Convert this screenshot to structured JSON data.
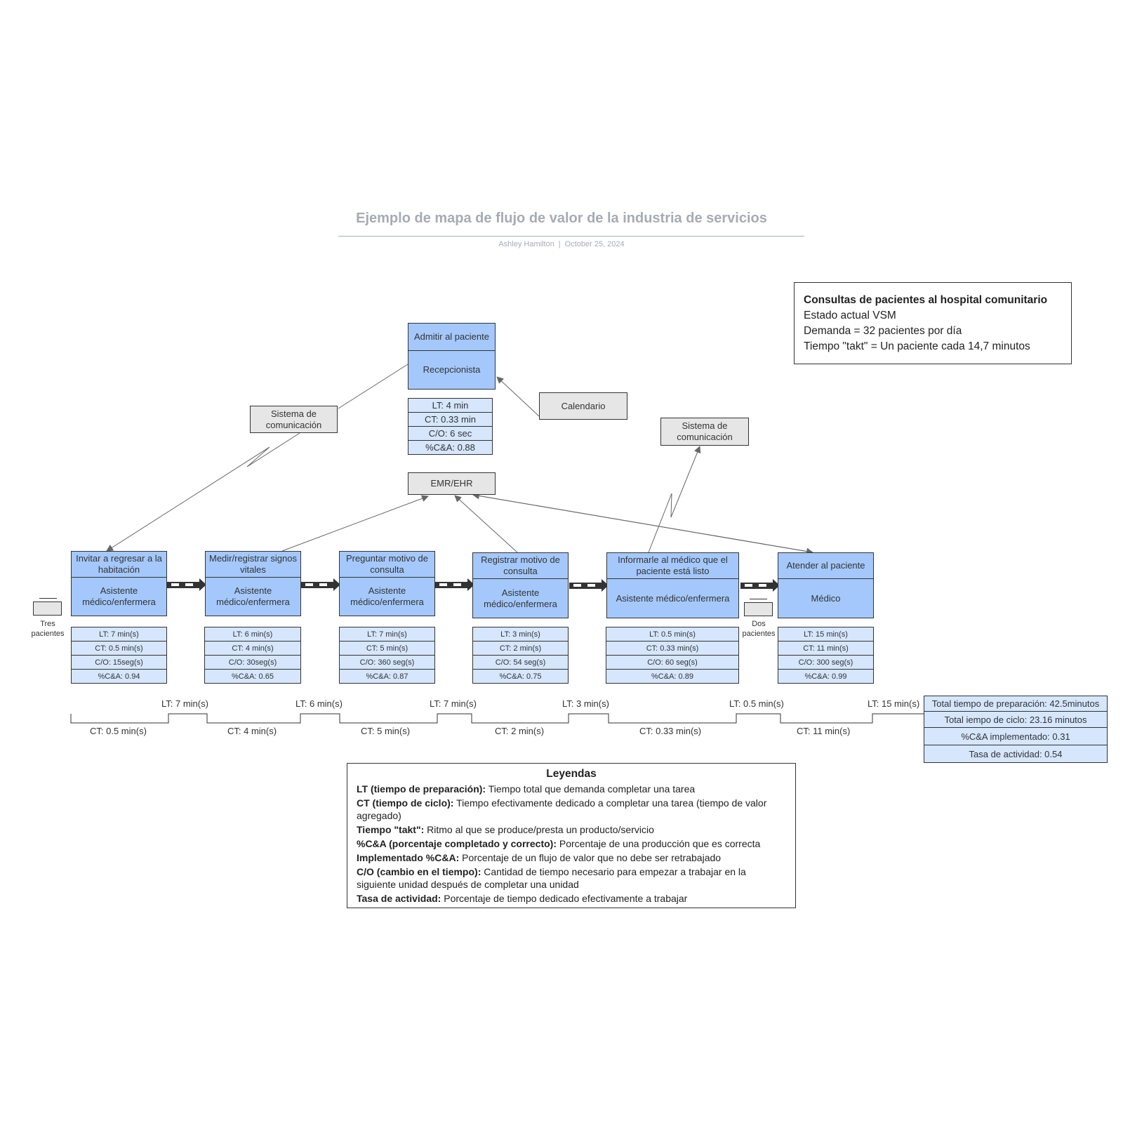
{
  "header": {
    "title": "Ejemplo de mapa de flujo de valor de la industria de servicios",
    "author": "Ashley Hamilton",
    "separator": "|",
    "date": "October 25, 2024"
  },
  "info_box": {
    "title": "Consultas de pacientes al hospital comunitario",
    "lines": [
      "Estado actual VSM",
      "Demanda = 32 pacientes por día",
      "Tiempo \"takt\" = Un paciente cada 14,7 minutos"
    ]
  },
  "admit": {
    "title": "Admitir al paciente",
    "role": "Recepcionista",
    "data": [
      "LT: 4 min",
      "CT: 0.33 min",
      "C/O: 6 sec",
      "%C&A: 0.88"
    ]
  },
  "external": {
    "calendar": "Calendario",
    "comm_left": "Sistema de comunicación",
    "comm_right": "Sistema de comunicación",
    "emr": "EMR/EHR"
  },
  "processes": [
    {
      "title": "Invitar a regresar a la habitación",
      "role": "Asistente médico/enfermera",
      "data": [
        "LT: 7 min(s)",
        "CT: 0.5 min(s)",
        "C/O: 15seg(s)",
        "%C&A: 0.94"
      ]
    },
    {
      "title": "Medir/registrar signos vitales",
      "role": "Asistente médico/enfermera",
      "data": [
        "LT: 6 min(s)",
        "CT: 4 min(s)",
        "C/O: 30seg(s)",
        "%C&A: 0.65"
      ]
    },
    {
      "title": "Preguntar motivo de consulta",
      "role": "Asistente médico/enfermera",
      "data": [
        "LT: 7 min(s)",
        "CT: 5 min(s)",
        "C/O: 360 seg(s)",
        "%C&A: 0.87"
      ]
    },
    {
      "title": "Registrar motivo de consulta",
      "role": "Asistente médico/enfermera",
      "data": [
        "LT: 3 min(s)",
        "CT: 2 min(s)",
        "C/O: 54 seg(s)",
        "%C&A: 0.75"
      ]
    },
    {
      "title": "Informarle al médico que el paciente está listo",
      "role": "Asistente médico/enfermera",
      "data": [
        "LT: 0.5 min(s)",
        "CT: 0.33 min(s)",
        "C/O: 60 seg(s)",
        "%C&A: 0.89"
      ]
    },
    {
      "title": "Atender al paciente",
      "role": "Médico",
      "data": [
        "LT: 15 min(s)",
        "CT: 11 min(s)",
        "C/O: 300 seg(s)",
        "%C&A: 0.99"
      ]
    }
  ],
  "inventory": {
    "first": "Tres pacientes",
    "second": "Dos pacientes"
  },
  "timeline": {
    "lt": [
      "LT: 7 min(s)",
      "LT: 6 min(s)",
      "LT: 7 min(s)",
      "LT: 3 min(s)",
      "LT: 0.5 min(s)",
      "LT: 15 min(s)"
    ],
    "ct": [
      "CT: 0.5 min(s)",
      "CT: 4 min(s)",
      "CT: 5 min(s)",
      "CT: 2 min(s)",
      "CT: 0.33 min(s)",
      "CT: 11 min(s)"
    ]
  },
  "totals": [
    "Total tiempo de preparación: 42.5minutos",
    "Total iempo de ciclo: 23.16 minutos",
    "%C&A implementado: 0.31",
    "Tasa de actividad: 0.54"
  ],
  "legend": {
    "title": "Leyendas",
    "items": [
      {
        "term": "LT (tiempo de preparación):",
        "def": " Tiempo total que demanda completar una tarea"
      },
      {
        "term": "CT (tiempo de ciclo):",
        "def": " Tiempo efectivamente dedicado a completar una tarea (tiempo de valor agregado)"
      },
      {
        "term": "Tiempo \"takt\":",
        "def": " Ritmo al que se produce/presta un producto/servicio"
      },
      {
        "term": "%C&A (porcentaje completado y correcto):",
        "def": " Porcentaje de una producción que es correcta"
      },
      {
        "term": "Implementado %C&A:",
        "def": " Porcentaje de un flujo de valor que no debe ser retrabajado"
      },
      {
        "term": "C/O (cambio en el tiempo):",
        "def": " Cantidad de tiempo necesario para empezar a trabajar en la siguiente unidad después de completar una unidad"
      },
      {
        "term": "Tasa de actividad:",
        "def": " Porcentaje de tiempo dedicado efectivamente a trabajar"
      }
    ]
  }
}
